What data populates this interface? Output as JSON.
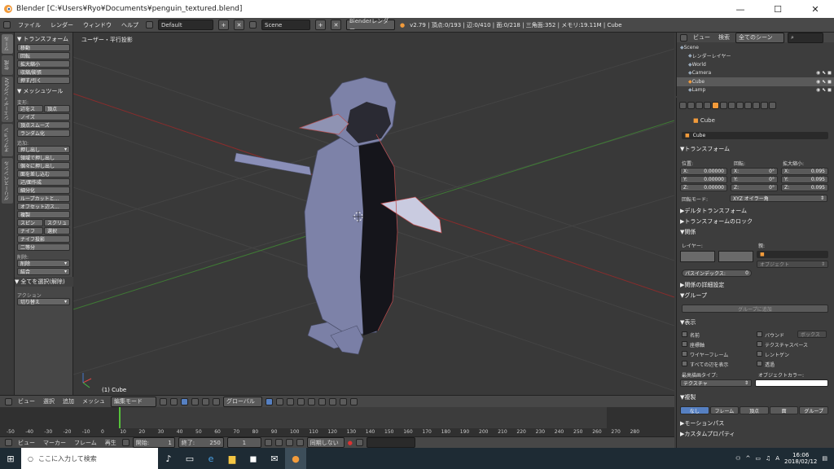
{
  "window": {
    "title": "Blender [C:¥Users¥Ryo¥Documents¥penguin_textured.blend]"
  },
  "info_header": {
    "menus": [
      "ファイル",
      "レンダー",
      "ウィンドウ",
      "ヘルプ"
    ],
    "layout": "Default",
    "scene": "Scene",
    "engine": "Blenderレンダー",
    "stats": "v2.79 | 頂点:0/193 | 辺:0/410 | 面:0/218 | 三角面:352 | メモリ:19.11M | Cube"
  },
  "tool_tabs": [
    "ツール",
    "作成",
    "シェーディング/UV",
    "オプション",
    "グリースペンシル"
  ],
  "tool_shelf": {
    "transform_header": "トランスフォーム",
    "transform_buttons": [
      "移動",
      "回転",
      "拡大縮小",
      "収縮/膨張",
      "押す/引く"
    ],
    "mesh_tools_header": "メッシュツール",
    "deform_label": "変形:",
    "deform_pairs": [
      [
        "辺をス",
        "頂点"
      ]
    ],
    "deform_buttons": [
      "ノイズ",
      "頂点スムーズ",
      "ランダム化"
    ],
    "add_label": "追加:",
    "add_dropdown": "押し出し",
    "add_buttons": [
      "領域で押し出し",
      "個々に押し出し",
      "面を差し込む",
      "辺/面作成",
      "細分化",
      "ループカットと...",
      "オフセット辺ス...",
      "複製"
    ],
    "add_pairs": [
      [
        "スピン",
        "スクリュ"
      ],
      [
        "ナイフ",
        "選択"
      ]
    ],
    "add_buttons2": [
      "ナイフ投影",
      "二等分"
    ],
    "remove_label": "削除:",
    "remove_dropdowns": [
      "削除",
      "結合"
    ],
    "select_header": "全てを選択(解除)",
    "action_label": "アクション",
    "action_value": "切り替え"
  },
  "viewport": {
    "view_label": "ユーザー・平行投影",
    "object_label": "(1) Cube"
  },
  "viewport_header": {
    "menus": [
      "ビュー",
      "選択",
      "追加",
      "メッシュ"
    ],
    "mode": "編集モード",
    "pivot": "グローバル"
  },
  "timeline": {
    "ruler": [
      "-50",
      "-40",
      "-30",
      "-20",
      "-10",
      "0",
      "10",
      "20",
      "30",
      "40",
      "50",
      "60",
      "70",
      "80",
      "90",
      "100",
      "110",
      "120",
      "130",
      "140",
      "150",
      "160",
      "170",
      "180",
      "190",
      "200",
      "210",
      "220",
      "230",
      "240",
      "250",
      "260",
      "270",
      "280"
    ],
    "menus": [
      "ビュー",
      "マーカー",
      "フレーム",
      "再生"
    ],
    "start_label": "開始:",
    "start": "1",
    "end_label": "終了:",
    "end": "250",
    "current": "1",
    "sync": "同期しない"
  },
  "outliner": {
    "menus": [
      "ビュー",
      "検索"
    ],
    "filter": "全てのシーン",
    "items": [
      {
        "name": "Scene",
        "indent": 0
      },
      {
        "name": "レンダーレイヤー",
        "indent": 1
      },
      {
        "name": "World",
        "indent": 1
      },
      {
        "name": "Camera",
        "indent": 1
      },
      {
        "name": "Cube",
        "indent": 1
      },
      {
        "name": "Lamp",
        "indent": 1
      }
    ]
  },
  "properties": {
    "breadcrumb": "Cube",
    "object_name": "Cube",
    "transform_header": "トランスフォーム",
    "location_label": "位置:",
    "rotation_label": "回転:",
    "scale_label": "拡大縮小:",
    "location": [
      {
        "axis": "X:",
        "value": "0.00000"
      },
      {
        "axis": "Y:",
        "value": "0.00000"
      },
      {
        "axis": "Z:",
        "value": "0.00000"
      }
    ],
    "rotation": [
      {
        "axis": "X:",
        "value": "0°"
      },
      {
        "axis": "Y:",
        "value": "0°"
      },
      {
        "axis": "Z:",
        "value": "0°"
      }
    ],
    "scale": [
      {
        "axis": "X:",
        "value": "0.095"
      },
      {
        "axis": "Y:",
        "value": "0.095"
      },
      {
        "axis": "Z:",
        "value": "0.095"
      }
    ],
    "rotation_mode_label": "回転モード:",
    "rotation_mode": "XYZ オイラー角",
    "delta_transform": "デルタトランスフォーム",
    "transform_lock": "トランスフォームのロック",
    "relations_header": "関係",
    "layer_label": "レイヤー:",
    "parent_label": "親:",
    "parent_type": "オブジェクト",
    "pass_index_label": "パスインデックス:",
    "pass_index": "0",
    "relations_extras": "関係の詳細設定",
    "groups_header": "グループ",
    "add_to_group": "グループに追加",
    "display_header": "表示",
    "display_left": [
      "名前",
      "座標軸",
      "ワイヤーフレーム",
      "すべての辺を表示"
    ],
    "display_right": [
      "バウンド",
      "テクスチャスペース",
      "レントゲン",
      "透過"
    ],
    "bound_type": "ボックス",
    "max_draw_label": "最高描画タイプ:",
    "max_draw": "テクスチャ",
    "object_color_label": "オブジェクトカラー:",
    "duplication_header": "複製",
    "dupli_options": [
      "なし",
      "フレーム",
      "頂点",
      "面",
      "グループ"
    ],
    "motion_paths": "モーションパス",
    "custom_props": "カスタムプロパティ"
  },
  "taskbar": {
    "search": "ここに入力して検索",
    "time": "16:06",
    "date": "2018/02/12"
  },
  "colors": {
    "accent": "#5680c2",
    "object_orange": "#f29b3b",
    "penguin": "#7d82a8",
    "grid_red": "#8a2c2c",
    "grid_green": "#3f7a35"
  }
}
